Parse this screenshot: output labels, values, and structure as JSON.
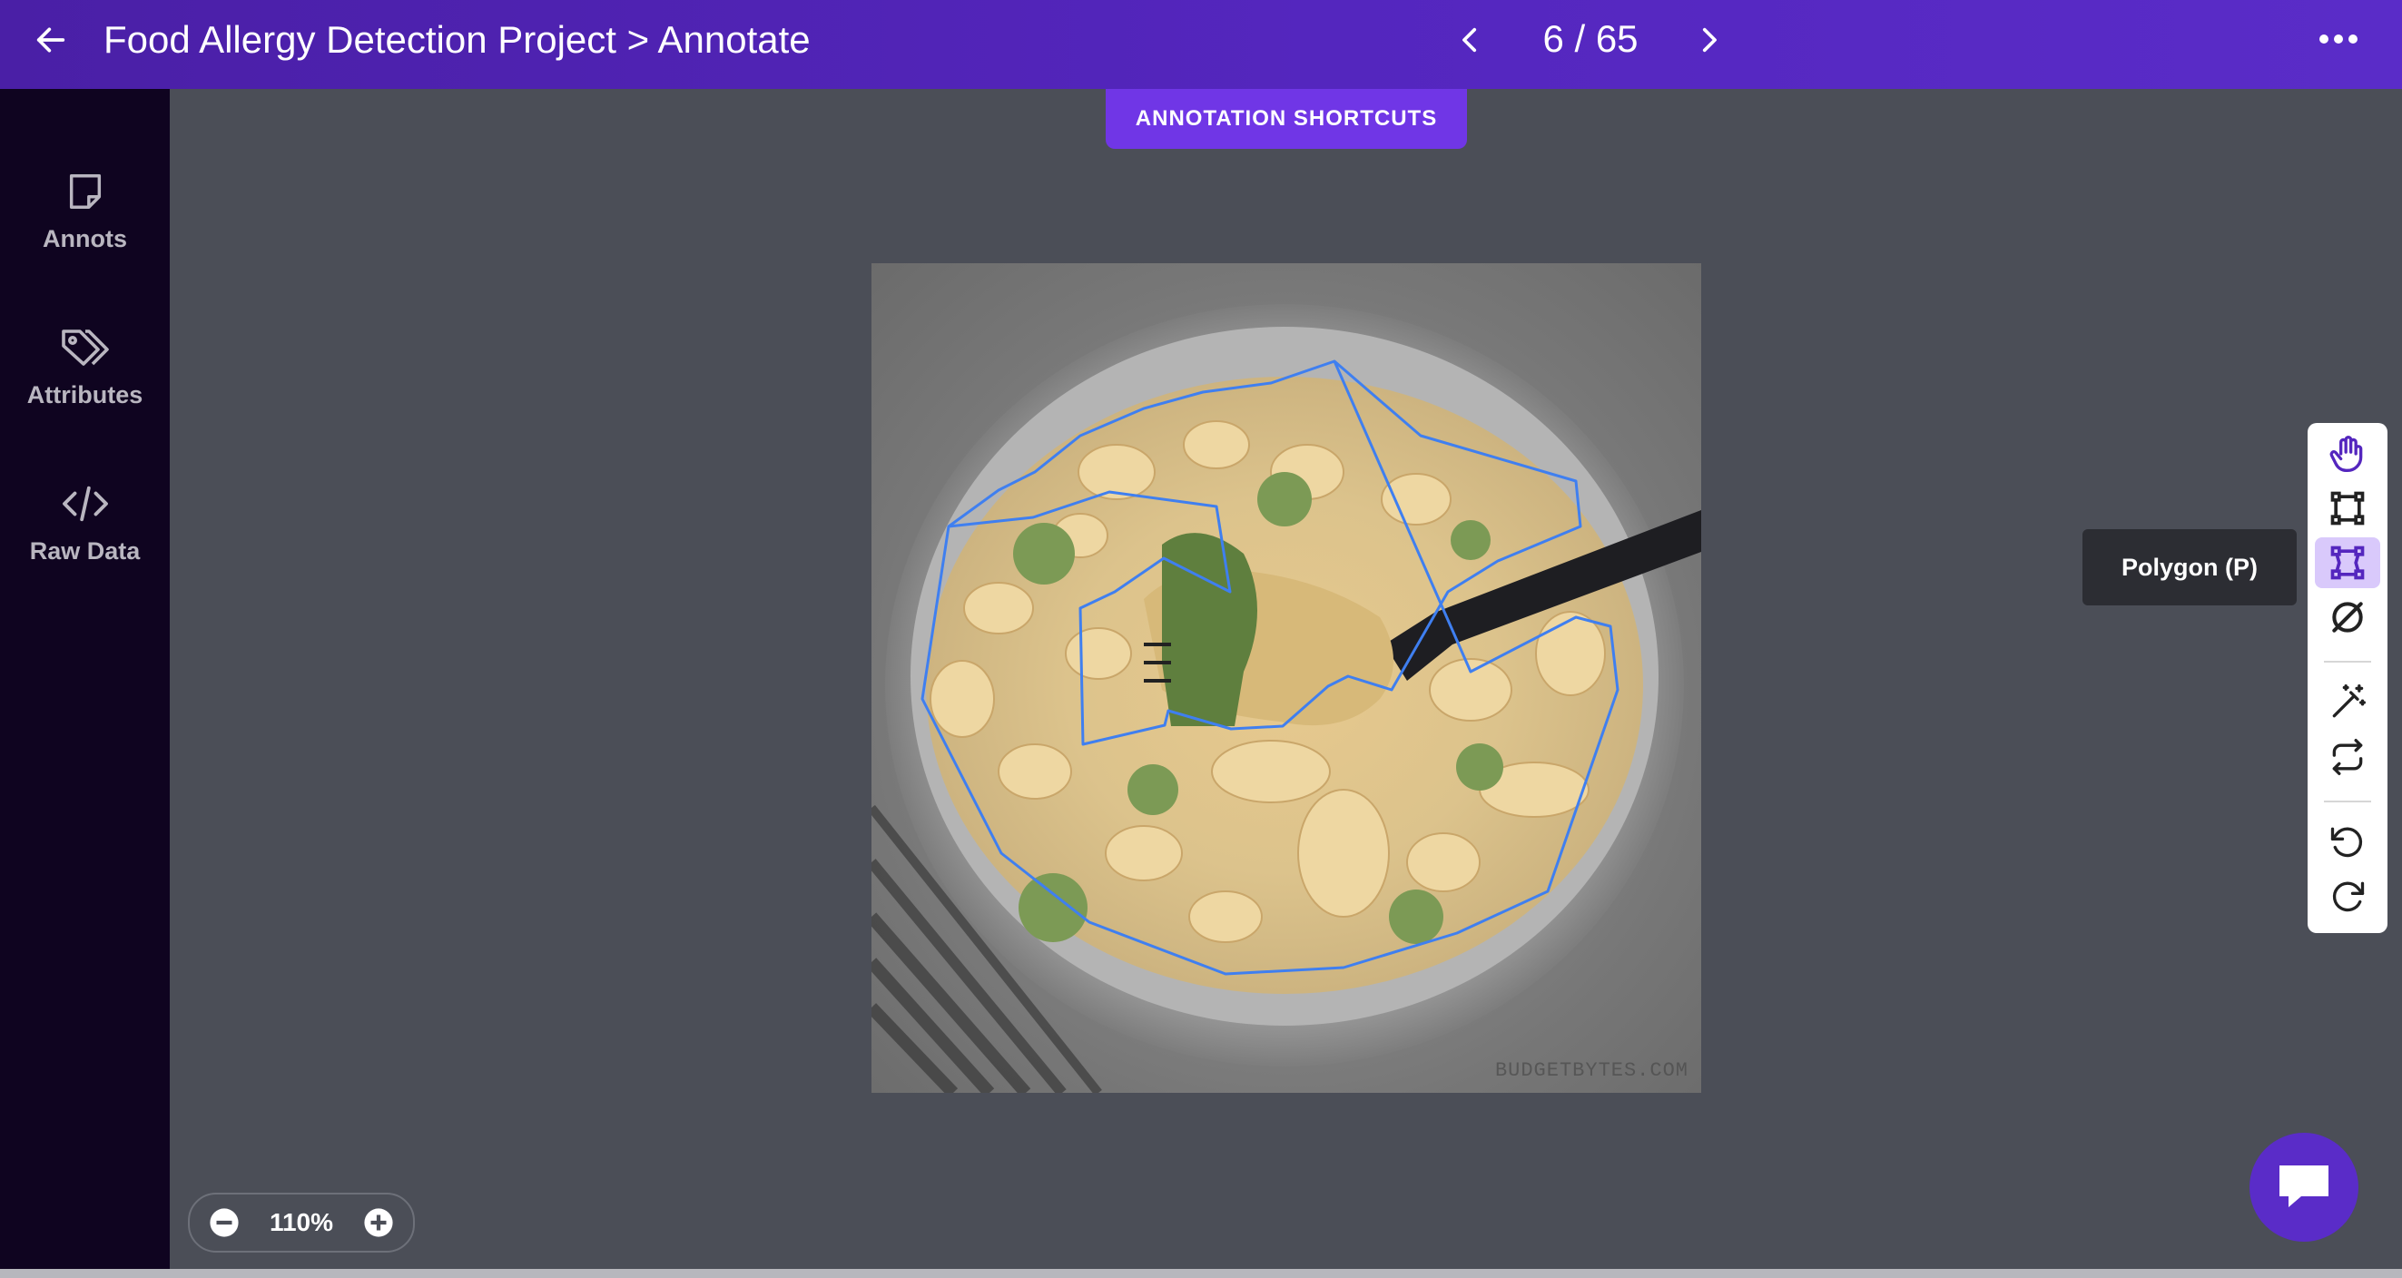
{
  "header": {
    "title": "Food Allergy Detection Project > Annotate",
    "counter": "6 / 65"
  },
  "sidebar": {
    "items": [
      {
        "label": "Annots",
        "icon": "note-icon"
      },
      {
        "label": "Attributes",
        "icon": "tags-icon"
      },
      {
        "label": "Raw Data",
        "icon": "code-icon"
      }
    ]
  },
  "canvas": {
    "shortcuts_label": "ANNOTATION SHORTCUTS",
    "watermark": "BUDGETBYTES.COM",
    "polygon_color": "#3f7ff0"
  },
  "toolbar": {
    "tools": [
      "hand-icon",
      "bounding-box-icon",
      "polygon-icon",
      "no-class-icon",
      "magic-wand-icon",
      "repeat-icon",
      "undo-icon",
      "redo-icon"
    ],
    "active_tool": "polygon-icon",
    "tooltip": "Polygon (P)"
  },
  "zoom": {
    "level": "110%"
  },
  "colors": {
    "accent": "#5426be",
    "sidebar_bg": "#0f0420",
    "canvas_bg": "#4b4e57"
  }
}
